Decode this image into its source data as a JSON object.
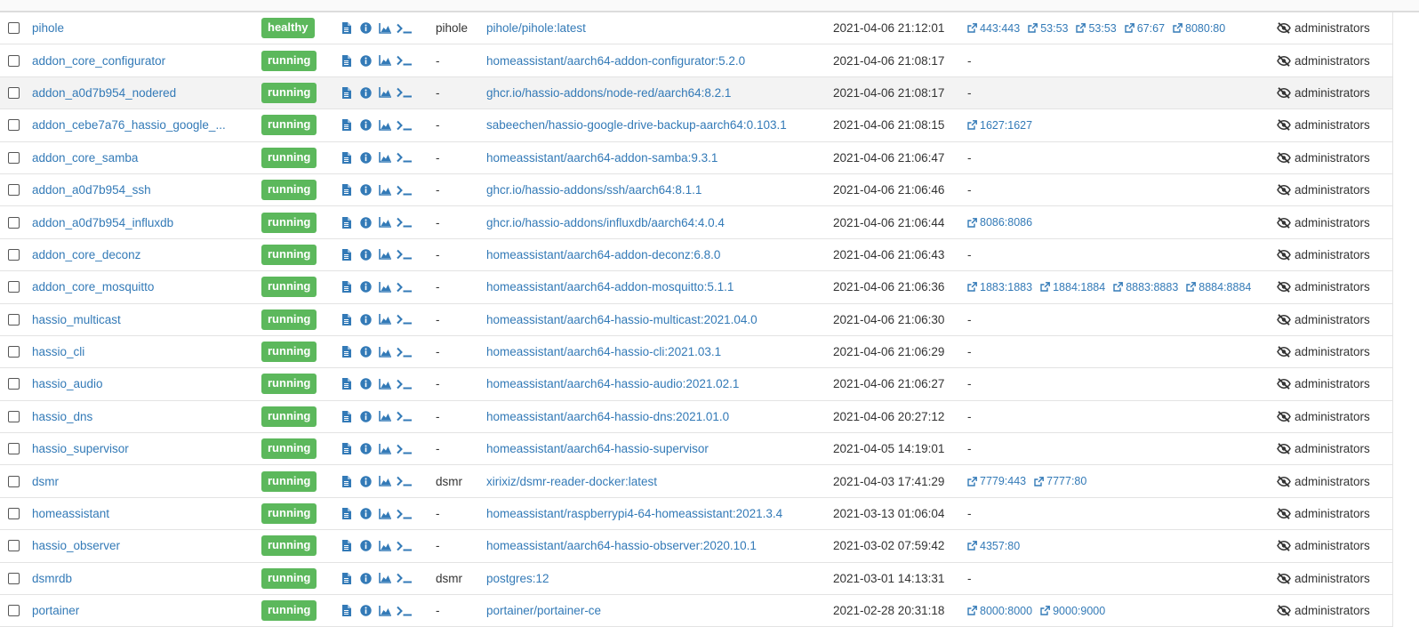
{
  "table": {
    "rows": [
      {
        "name": "pihole",
        "state": "healthy",
        "stack": "pihole",
        "image": "pihole/pihole:latest",
        "created": "2021-04-06 21:12:01",
        "ports": [
          "443:443",
          "53:53",
          "53:53",
          "67:67",
          "8080:80"
        ],
        "ownership": "administrators",
        "highlight": false
      },
      {
        "name": "addon_core_configurator",
        "state": "running",
        "stack": "-",
        "image": "homeassistant/aarch64-addon-configurator:5.2.0",
        "created": "2021-04-06 21:08:17",
        "ports": [],
        "ports_text": "-",
        "ownership": "administrators",
        "highlight": false
      },
      {
        "name": "addon_a0d7b954_nodered",
        "state": "running",
        "stack": "-",
        "image": "ghcr.io/hassio-addons/node-red/aarch64:8.2.1",
        "created": "2021-04-06 21:08:17",
        "ports": [],
        "ports_text": "-",
        "ownership": "administrators",
        "highlight": true
      },
      {
        "name": "addon_cebe7a76_hassio_google_...",
        "state": "running",
        "stack": "-",
        "image": "sabeechen/hassio-google-drive-backup-aarch64:0.103.1",
        "created": "2021-04-06 21:08:15",
        "ports": [
          "1627:1627"
        ],
        "ownership": "administrators",
        "highlight": false
      },
      {
        "name": "addon_core_samba",
        "state": "running",
        "stack": "-",
        "image": "homeassistant/aarch64-addon-samba:9.3.1",
        "created": "2021-04-06 21:06:47",
        "ports": [],
        "ports_text": "-",
        "ownership": "administrators",
        "highlight": false
      },
      {
        "name": "addon_a0d7b954_ssh",
        "state": "running",
        "stack": "-",
        "image": "ghcr.io/hassio-addons/ssh/aarch64:8.1.1",
        "created": "2021-04-06 21:06:46",
        "ports": [],
        "ports_text": "-",
        "ownership": "administrators",
        "highlight": false
      },
      {
        "name": "addon_a0d7b954_influxdb",
        "state": "running",
        "stack": "-",
        "image": "ghcr.io/hassio-addons/influxdb/aarch64:4.0.4",
        "created": "2021-04-06 21:06:44",
        "ports": [
          "8086:8086"
        ],
        "ownership": "administrators",
        "highlight": false
      },
      {
        "name": "addon_core_deconz",
        "state": "running",
        "stack": "-",
        "image": "homeassistant/aarch64-addon-deconz:6.8.0",
        "created": "2021-04-06 21:06:43",
        "ports": [],
        "ports_text": "-",
        "ownership": "administrators",
        "highlight": false
      },
      {
        "name": "addon_core_mosquitto",
        "state": "running",
        "stack": "-",
        "image": "homeassistant/aarch64-addon-mosquitto:5.1.1",
        "created": "2021-04-06 21:06:36",
        "ports": [
          "1883:1883",
          "1884:1884",
          "8883:8883",
          "8884:8884"
        ],
        "ownership": "administrators",
        "highlight": false
      },
      {
        "name": "hassio_multicast",
        "state": "running",
        "stack": "-",
        "image": "homeassistant/aarch64-hassio-multicast:2021.04.0",
        "created": "2021-04-06 21:06:30",
        "ports": [],
        "ports_text": "-",
        "ownership": "administrators",
        "highlight": false
      },
      {
        "name": "hassio_cli",
        "state": "running",
        "stack": "-",
        "image": "homeassistant/aarch64-hassio-cli:2021.03.1",
        "created": "2021-04-06 21:06:29",
        "ports": [],
        "ports_text": "-",
        "ownership": "administrators",
        "highlight": false
      },
      {
        "name": "hassio_audio",
        "state": "running",
        "stack": "-",
        "image": "homeassistant/aarch64-hassio-audio:2021.02.1",
        "created": "2021-04-06 21:06:27",
        "ports": [],
        "ports_text": "-",
        "ownership": "administrators",
        "highlight": false
      },
      {
        "name": "hassio_dns",
        "state": "running",
        "stack": "-",
        "image": "homeassistant/aarch64-hassio-dns:2021.01.0",
        "created": "2021-04-06 20:27:12",
        "ports": [],
        "ports_text": "-",
        "ownership": "administrators",
        "highlight": false
      },
      {
        "name": "hassio_supervisor",
        "state": "running",
        "stack": "-",
        "image": "homeassistant/aarch64-hassio-supervisor",
        "created": "2021-04-05 14:19:01",
        "ports": [],
        "ports_text": "-",
        "ownership": "administrators",
        "highlight": false
      },
      {
        "name": "dsmr",
        "state": "running",
        "stack": "dsmr",
        "image": "xirixiz/dsmr-reader-docker:latest",
        "created": "2021-04-03 17:41:29",
        "ports": [
          "7779:443",
          "7777:80"
        ],
        "ownership": "administrators",
        "highlight": false
      },
      {
        "name": "homeassistant",
        "state": "running",
        "stack": "-",
        "image": "homeassistant/raspberrypi4-64-homeassistant:2021.3.4",
        "created": "2021-03-13 01:06:04",
        "ports": [],
        "ports_text": "-",
        "ownership": "administrators",
        "highlight": false
      },
      {
        "name": "hassio_observer",
        "state": "running",
        "stack": "-",
        "image": "homeassistant/aarch64-hassio-observer:2020.10.1",
        "created": "2021-03-02 07:59:42",
        "ports": [
          "4357:80"
        ],
        "ownership": "administrators",
        "highlight": false
      },
      {
        "name": "dsmrdb",
        "state": "running",
        "stack": "dsmr",
        "image": "postgres:12",
        "created": "2021-03-01 14:13:31",
        "ports": [],
        "ports_text": "-",
        "ownership": "administrators",
        "highlight": false
      },
      {
        "name": "portainer",
        "state": "running",
        "stack": "-",
        "image": "portainer/portainer-ce",
        "created": "2021-02-28 20:31:18",
        "ports": [
          "8000:8000",
          "9000:9000"
        ],
        "ownership": "administrators",
        "highlight": false
      }
    ]
  },
  "colors": {
    "link": "#337ab7",
    "badge": "#5cb85c",
    "icon": "#337ab7"
  },
  "icons": {
    "actions": [
      "logs-icon",
      "inspect-icon",
      "stats-icon",
      "console-icon"
    ],
    "port": "external-link-icon",
    "ownership": "eye-slash-icon"
  }
}
